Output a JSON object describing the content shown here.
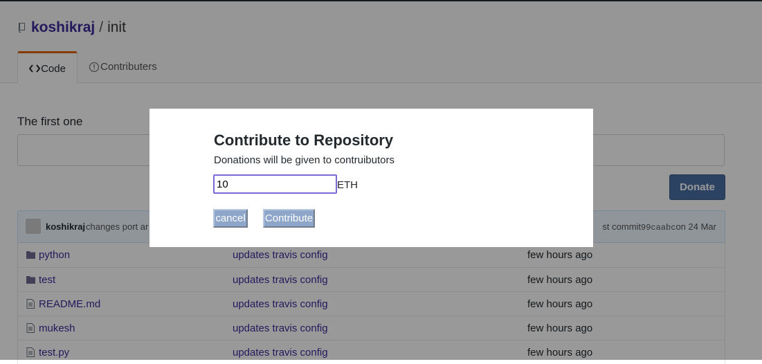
{
  "repo": {
    "owner": "koshikraj",
    "separator": "/",
    "name": "init"
  },
  "tabs": [
    {
      "icon": "code-icon",
      "label": "Code"
    },
    {
      "icon": "info-icon",
      "label": "Contributers"
    }
  ],
  "description": "The first one",
  "donate_button": "Donate",
  "commit": {
    "author": "koshikraj",
    "message": "changes port ar",
    "prefix": "st commit",
    "hash": "99caabc",
    "date": "on 24 Mar"
  },
  "files": [
    {
      "type": "folder",
      "name": "python",
      "message": "updates travis config",
      "age": "few hours ago"
    },
    {
      "type": "folder",
      "name": "test",
      "message": "updates travis config",
      "age": "few hours ago"
    },
    {
      "type": "file",
      "name": "README.md",
      "message": "updates travis config",
      "age": "few hours ago"
    },
    {
      "type": "file",
      "name": "mukesh",
      "message": "updates travis config",
      "age": "few hours ago"
    },
    {
      "type": "file",
      "name": "test.py",
      "message": "updates travis config",
      "age": "few hours ago"
    }
  ],
  "modal": {
    "title": "Contribute to Repository",
    "subtitle": "Donations will be given to contruibutors",
    "amount_value": "10",
    "unit": "ETH",
    "cancel_label": "cancel",
    "contribute_label": "Contribute"
  },
  "colors": {
    "link": "#3b2a99",
    "tab_accent": "#e36209",
    "donate": "#4a6fa5",
    "overlay": "rgba(0,0,0,0.4)"
  }
}
